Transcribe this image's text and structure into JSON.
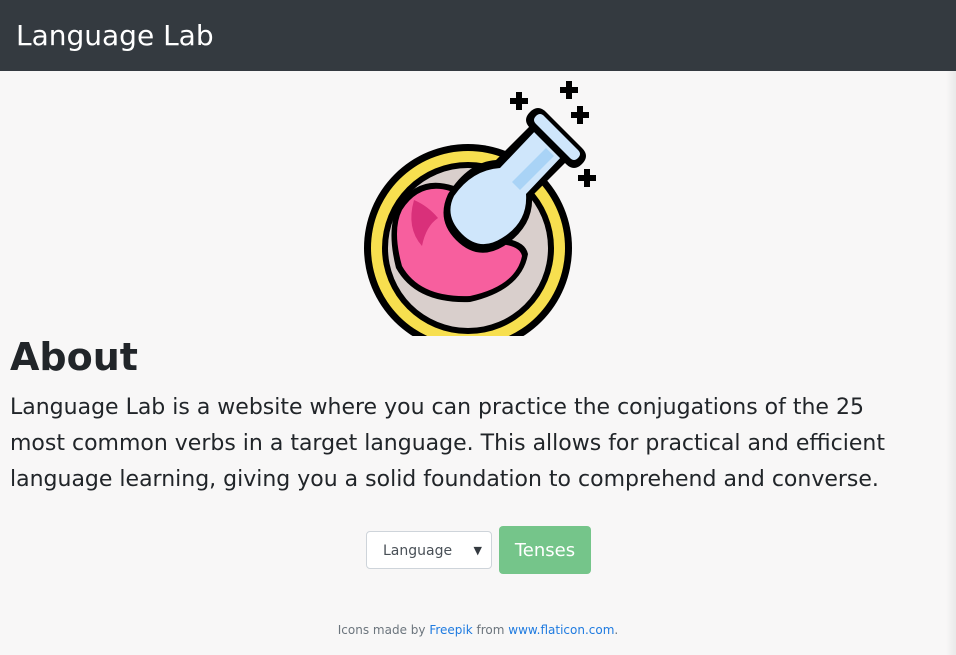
{
  "navbar": {
    "brand": "Language Lab"
  },
  "logo": {
    "icon": "potion-flask-icon",
    "colors": {
      "ring": "#f7df4f",
      "liquid": "#f75f9e",
      "glass": "#cfe6fb",
      "outline": "#000000"
    }
  },
  "about": {
    "title": "About",
    "text": "Language Lab is a website where you can practice the conjugations of the 25 most common verbs in a target language. This allows for practical and efficient language learning, giving you a solid foundation to comprehend and converse."
  },
  "controls": {
    "language_select": {
      "selected": "Language",
      "caret": "▼"
    },
    "tenses_button": {
      "label": "Tenses",
      "color": "#75c58a"
    }
  },
  "footer": {
    "prefix": "Icons made by",
    "author_link": "Freepik",
    "middle": "from",
    "site_link": "www.flaticon.com",
    "suffix": "."
  }
}
